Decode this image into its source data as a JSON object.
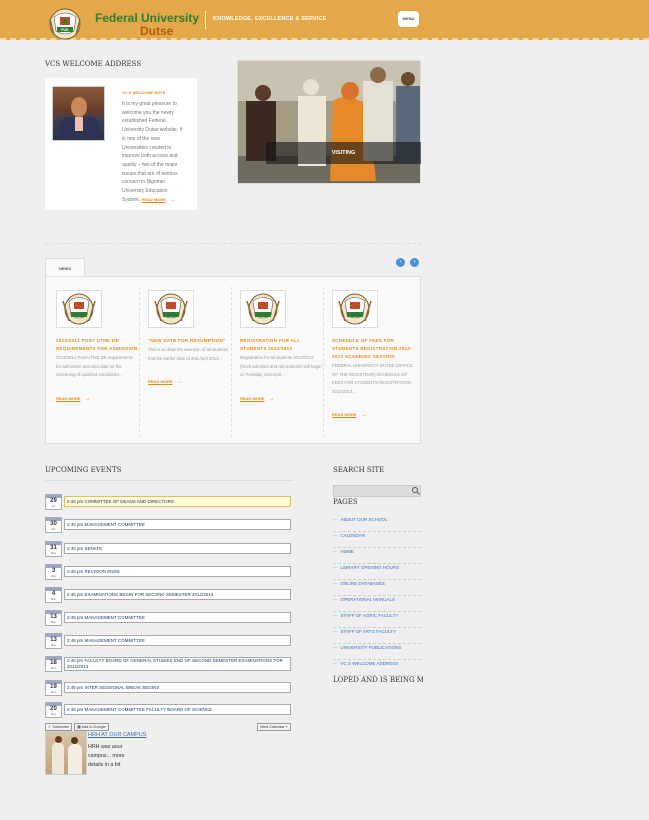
{
  "header": {
    "university_line1": "Federal University",
    "university_line2": "Dutse",
    "crest_text": "FUD",
    "motto": "KNOWLEDGE, EXCELLENCE & SERVICE",
    "menu_label": "MENU"
  },
  "vc": {
    "section_title": "VCS WELCOME ADDRESS",
    "heading": "VC S WELCOME NOTE",
    "text": "It is my great pleasure to welcome you the newly established Federal University Dutse website. It is one of the new Universities created to improve both access and quality – two of the major issues that are of serious concern in Nigerian University Education System.",
    "read_more": "READ MORE"
  },
  "slider": {
    "caption": "VISITING"
  },
  "news": {
    "tab_label": "NEWS",
    "items": [
      {
        "title": "2013/2014 POST UTME DE REQUIREMENTS FOR ADMISSION",
        "body": "2013/2014 Post UTME DE requirements for admission and also date for the Screening of qualified candidates...",
        "read_more": "READ MORE"
      },
      {
        "title": "\"NEW DATE FOR RESUMPTION\"",
        "body": "This is to draw the attention of all students that the earlier date of 2nd April 2013...",
        "read_more": "READ MORE"
      },
      {
        "title": "REGISTRATION FOR ALL STUDENTS 2012/2013",
        "body": "Registration for all students 2012/2013 (fresh admitted and old students) will begin on Tuesday, 2nd April...",
        "read_more": "READ MORE"
      },
      {
        "title": "SCHEDULE OF FEES FOR STUDENTS REGISTRATION 2012-2013 ACADEMIC SESSION",
        "body": "FEDERAL UNIVERSITY DUTSE (OFFICE OF THE REGISTRAR) SCHEDULE OF FEES FOR STUDENTS REGISTRATION 2012/2013...",
        "read_more": "READ MORE"
      }
    ]
  },
  "events": {
    "title": "UPCOMING EVENTS",
    "items": [
      {
        "day": "29",
        "month": "Apr",
        "text": "2:45 pm COMMITTEE OF DEANS AND DIRECTORS"
      },
      {
        "day": "30",
        "month": "Apr",
        "text": "2:45 pm MANAGEMENT COMMITTEE"
      },
      {
        "day": "31",
        "month": "May",
        "text": "2:45 pm SENATE"
      },
      {
        "day": "3",
        "month": "May",
        "text": "2:45 pm REVISION ENDS"
      },
      {
        "day": "4",
        "month": "May",
        "text": "2:45 pm EXAMINATIONS BEGIN FOR SECOND SEMESTER 2012/2013"
      },
      {
        "day": "13",
        "month": "May",
        "text": "2:45 pm MANAGEMENT COMMITTEE"
      },
      {
        "day": "13",
        "month": "May",
        "text": "2:45 pm MANAGEMENT COMMITTEE"
      },
      {
        "day": "18",
        "month": "May",
        "text": "2:45 pm FACULTY BOARD OF GENERAL STUDIES END OF SECOND SEMESTER EXAMINATIONS FOR 2012/2013"
      },
      {
        "day": "19",
        "month": "May",
        "text": "2:45 pm INTER SESSIONAL BREAK BEGINS"
      },
      {
        "day": "20",
        "month": "May",
        "text": "2:45 pm MANAGEMENT COMMITTEE FACULTY BOARD OF SCIENCE"
      }
    ],
    "subscribe_label": "Subscribe",
    "add_google_label": "Add to Google",
    "view_calendar_label": "View Calendar"
  },
  "hrh": {
    "title": "HRH AT OUR CAMPUS",
    "text": "HRH was aour campus... more details in a bit"
  },
  "sidebar": {
    "search_title": "SEARCH SITE",
    "pages_title": "PAGES",
    "pages": [
      "ABOUT OUR SCHOOL",
      "CALENDAR",
      "HOME",
      "LIBRARY OPENING HOURS",
      "ONLINE DATABASES",
      "OPERATIONAL MANUALS",
      "STAFF OF AGRIC FACULTY",
      "STAFF OF ARTS FACULTY",
      "UNIVERSITY PUBLICATIONS",
      "VC S WELCOME ADDRESS"
    ],
    "footer_note": "LOPED AND IS BEING MAINTAI"
  },
  "colors": {
    "header_bg": "#e3a84a",
    "accent_orange": "#e38a1a",
    "link_blue": "#3b6fb6",
    "brand_green": "#2e7d32"
  }
}
